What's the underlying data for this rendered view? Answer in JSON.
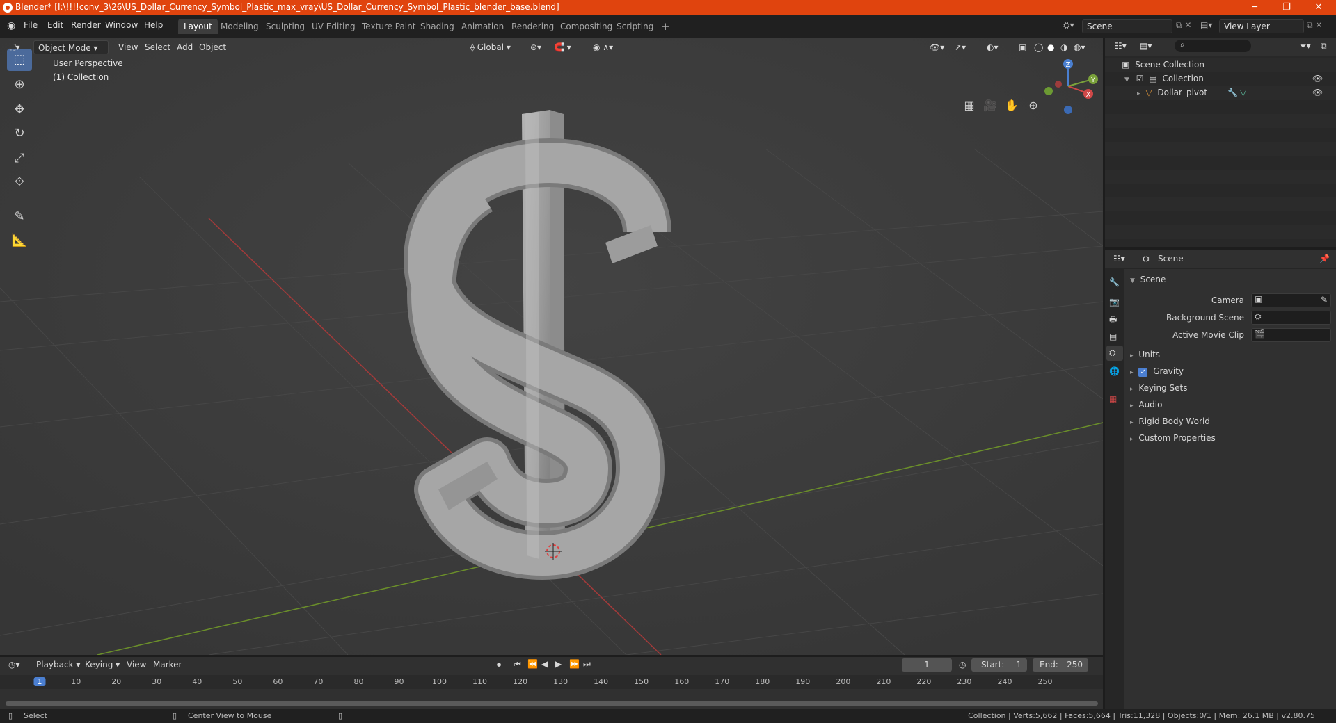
{
  "window": {
    "title": "Blender* [I:\\!!!!conv_3\\26\\US_Dollar_Currency_Symbol_Plastic_max_vray\\US_Dollar_Currency_Symbol_Plastic_blender_base.blend]",
    "minimize": "─",
    "restore": "❐",
    "close": "✕"
  },
  "menubar": {
    "menus": [
      "File",
      "Edit",
      "Render",
      "Window",
      "Help"
    ],
    "workspaces": [
      "Layout",
      "Modeling",
      "Sculpting",
      "UV Editing",
      "Texture Paint",
      "Shading",
      "Animation",
      "Rendering",
      "Compositing",
      "Scripting"
    ],
    "active_workspace": "Layout",
    "add_tab": "+",
    "scene": "Scene",
    "view_layer": "View Layer"
  },
  "viewport": {
    "mode": "Object Mode",
    "menus": [
      "View",
      "Select",
      "Add",
      "Object"
    ],
    "transform_orientation": "Global",
    "overlay_title": "User Perspective",
    "overlay_collection": "(1) Collection",
    "gizmo_axes": {
      "z": "Z",
      "x": "X",
      "y": "Y"
    }
  },
  "outliner": {
    "root": "Scene Collection",
    "collection": "Collection",
    "object": "Dollar_pivot"
  },
  "properties": {
    "header": "Scene",
    "panel": "Scene",
    "fields": [
      {
        "label": "Camera",
        "value": ""
      },
      {
        "label": "Background Scene",
        "value": ""
      },
      {
        "label": "Active Movie Clip",
        "value": ""
      }
    ],
    "sections": [
      "Units",
      "Gravity",
      "Keying Sets",
      "Audio",
      "Rigid Body World",
      "Custom Properties"
    ],
    "gravity_checked": true
  },
  "timeline": {
    "menus": [
      "Playback",
      "Keying",
      "View",
      "Marker"
    ],
    "current_frame": "1",
    "start_label": "Start:",
    "start": "1",
    "end_label": "End:",
    "end": "250",
    "ticks": [
      "1",
      "10",
      "20",
      "30",
      "40",
      "50",
      "60",
      "70",
      "80",
      "90",
      "100",
      "110",
      "120",
      "130",
      "140",
      "150",
      "160",
      "170",
      "180",
      "190",
      "200",
      "210",
      "220",
      "230",
      "240",
      "250"
    ]
  },
  "statusbar": {
    "select": "Select",
    "center_view": "Center View to Mouse",
    "stats": "Collection | Verts:5,662 | Faces:5,664 | Tris:11,328 | Objects:0/1 | Mem: 26.1 MB | v2.80.75"
  }
}
